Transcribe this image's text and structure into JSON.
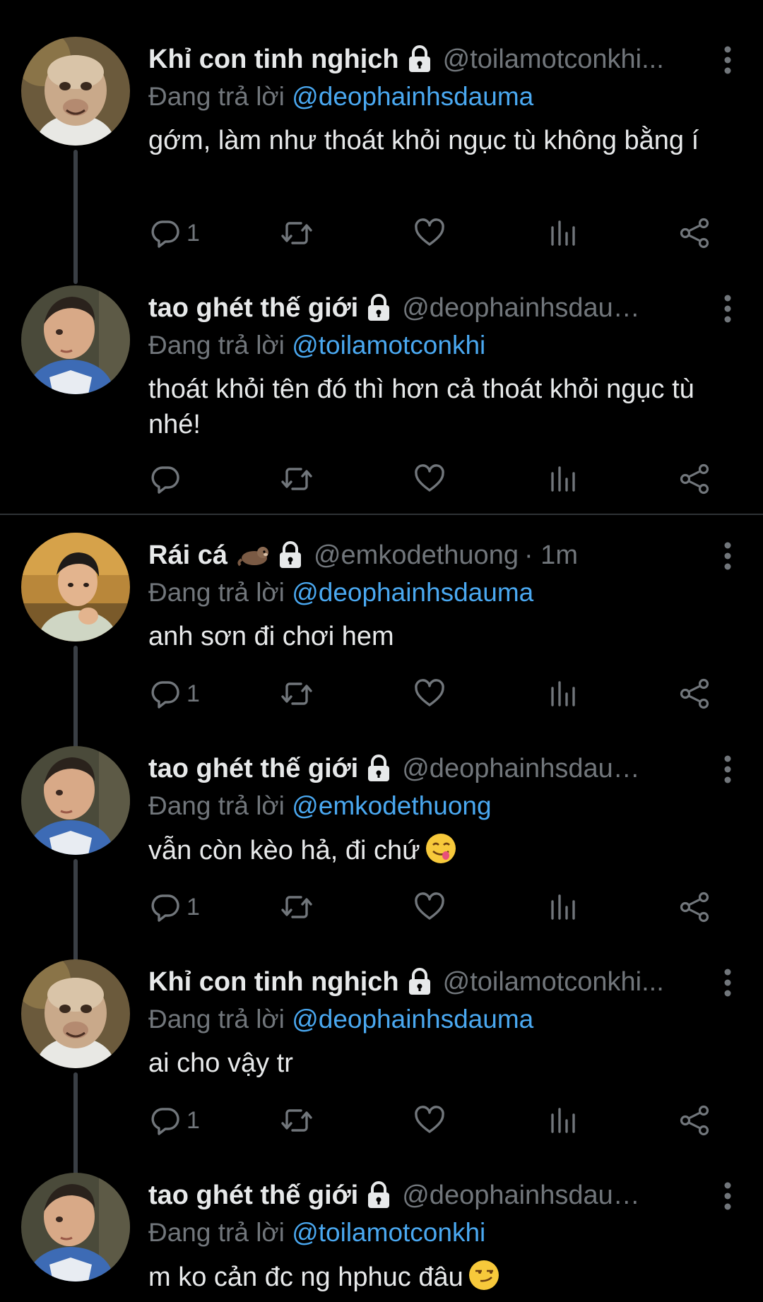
{
  "tweets": [
    {
      "name": "Khỉ con tinh nghịch",
      "handle": "@toilamotconkhi...",
      "reply_prefix": "Đang trả lời ",
      "reply_to": "@deophainhsdauma",
      "text": "gớm, làm như thoát khỏi ngục tù không bằng í",
      "reply_count": "1",
      "avatar": "monkey"
    },
    {
      "name": "tao ghét thế giới",
      "handle": "@deophainhsdaum...",
      "reply_prefix": "Đang trả lời ",
      "reply_to": "@toilamotconkhi",
      "text": "thoát khỏi tên đó thì hơn cả thoát khỏi ngục tù nhé!",
      "reply_count": "",
      "avatar": "child"
    },
    {
      "name": "Rái cá",
      "handle": "@emkodethuong",
      "time": "· 1m",
      "reply_prefix": "Đang trả lời ",
      "reply_to": "@deophainhsdauma",
      "text": "anh sơn đi chơi hem",
      "reply_count": "1",
      "avatar": "boy",
      "name_emoji": "otter"
    },
    {
      "name": "tao ghét thế giới",
      "handle": "@deophainhsdaum...",
      "reply_prefix": "Đang trả lời ",
      "reply_to": "@emkodethuong",
      "text": "vẫn còn kèo hả, đi chứ",
      "text_emoji": "face-savoring-food",
      "reply_count": "1",
      "avatar": "child"
    },
    {
      "name": "Khỉ con tinh nghịch",
      "handle": "@toilamotconkhi...",
      "reply_prefix": "Đang trả lời ",
      "reply_to": "@deophainhsdauma",
      "text": "ai cho vậy tr",
      "reply_count": "1",
      "avatar": "monkey"
    },
    {
      "name": "tao ghét thế giới",
      "handle": "@deophainhsdaum...",
      "reply_prefix": "Đang trả lời ",
      "reply_to": "@toilamotconkhi",
      "text": "m ko cản đc ng hphuc đâu",
      "text_emoji": "smirking-face",
      "avatar": "child"
    }
  ],
  "icons": {
    "reply": "reply-icon",
    "retweet": "retweet-icon",
    "like": "heart-icon",
    "views": "views-icon",
    "share": "share-icon",
    "more": "more-icon",
    "lock": "lock-icon"
  },
  "colors": {
    "background": "#000000",
    "text": "#e7e9ea",
    "muted": "#71767b",
    "mention": "#4aa8f0",
    "thread_line": "#3a3f45"
  }
}
